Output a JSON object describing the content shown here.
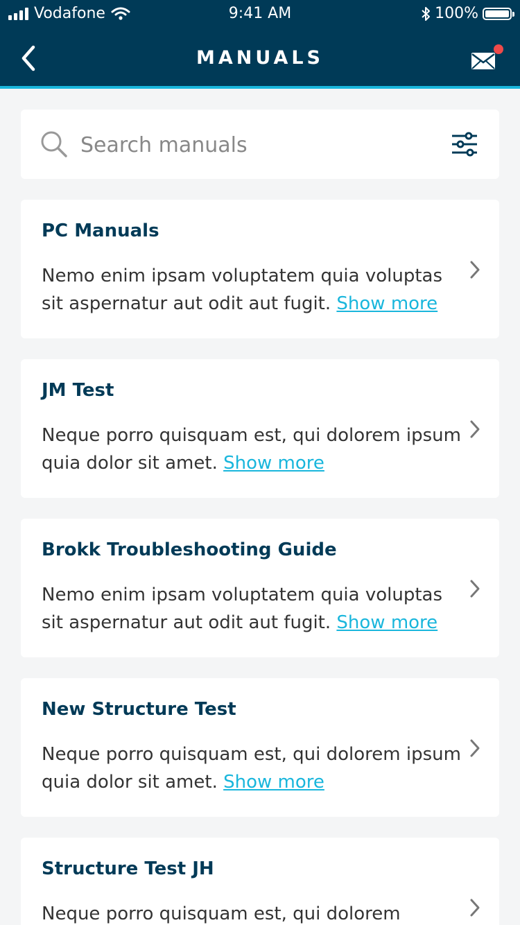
{
  "status_bar": {
    "carrier": "Vodafone",
    "time": "9:41 AM",
    "battery": "100%",
    "battery_level": 1.0
  },
  "nav": {
    "title": "MANUALS",
    "back_icon": "chevron-left-icon",
    "mail_icon": "mail-icon",
    "notification_color": "#ef4a4a"
  },
  "search": {
    "placeholder": "Search manuals",
    "icon": "search-icon",
    "filter_icon": "filter-sliders-icon"
  },
  "colors": {
    "header": "#003a57",
    "accent": "#19b6dc",
    "background": "#f4f5f6",
    "title": "#003a57"
  },
  "manuals": [
    {
      "title": "PC Manuals",
      "description": "Nemo enim ipsam voluptatem quia voluptas sit aspernatur aut odit aut fugit.",
      "link": "Show more"
    },
    {
      "title": "JM Test",
      "description": "Neque porro quisquam est, qui dolorem ipsum quia dolor sit amet.",
      "link": "Show more"
    },
    {
      "title": "Brokk Troubleshooting Guide",
      "description": "Nemo enim ipsam voluptatem quia voluptas sit aspernatur aut odit aut fugit.",
      "link": "Show more"
    },
    {
      "title": "New Structure Test",
      "description": "Neque porro quisquam est, qui dolorem ipsum quia dolor sit amet.",
      "link": "Show more"
    },
    {
      "title": "Structure Test JH",
      "description": "Neque porro quisquam est, qui dolorem",
      "link": ""
    }
  ]
}
